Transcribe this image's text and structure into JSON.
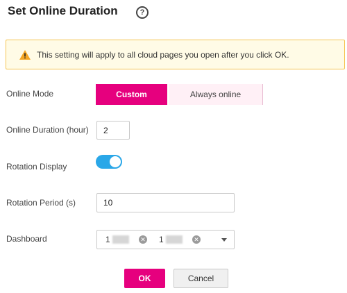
{
  "dialog": {
    "title": "Set Online Duration",
    "help_icon": "question-circle-icon"
  },
  "notice": {
    "icon": "warning-triangle-icon",
    "text": "This setting will apply to all cloud pages you open after you click OK.",
    "colors": {
      "background": "#fffbe6",
      "border": "#f5c451",
      "icon": "#f5a623"
    }
  },
  "online_mode": {
    "label": "Online Mode",
    "options": [
      "Custom",
      "Always online"
    ],
    "selected": "Custom"
  },
  "online_duration": {
    "label": "Online Duration (hour)",
    "value": "2"
  },
  "rotation_display": {
    "label": "Rotation Display",
    "enabled": true
  },
  "rotation_period": {
    "label": "Rotation Period (s)",
    "value": "10"
  },
  "dashboard": {
    "label": "Dashboard",
    "tags": [
      {
        "text": "1"
      },
      {
        "text": "1"
      }
    ],
    "dropdown_icon": "caret-down-icon"
  },
  "buttons": {
    "ok": "OK",
    "cancel": "Cancel"
  },
  "colors": {
    "accent": "#e6007e",
    "toggle_on": "#2aa7e8"
  }
}
